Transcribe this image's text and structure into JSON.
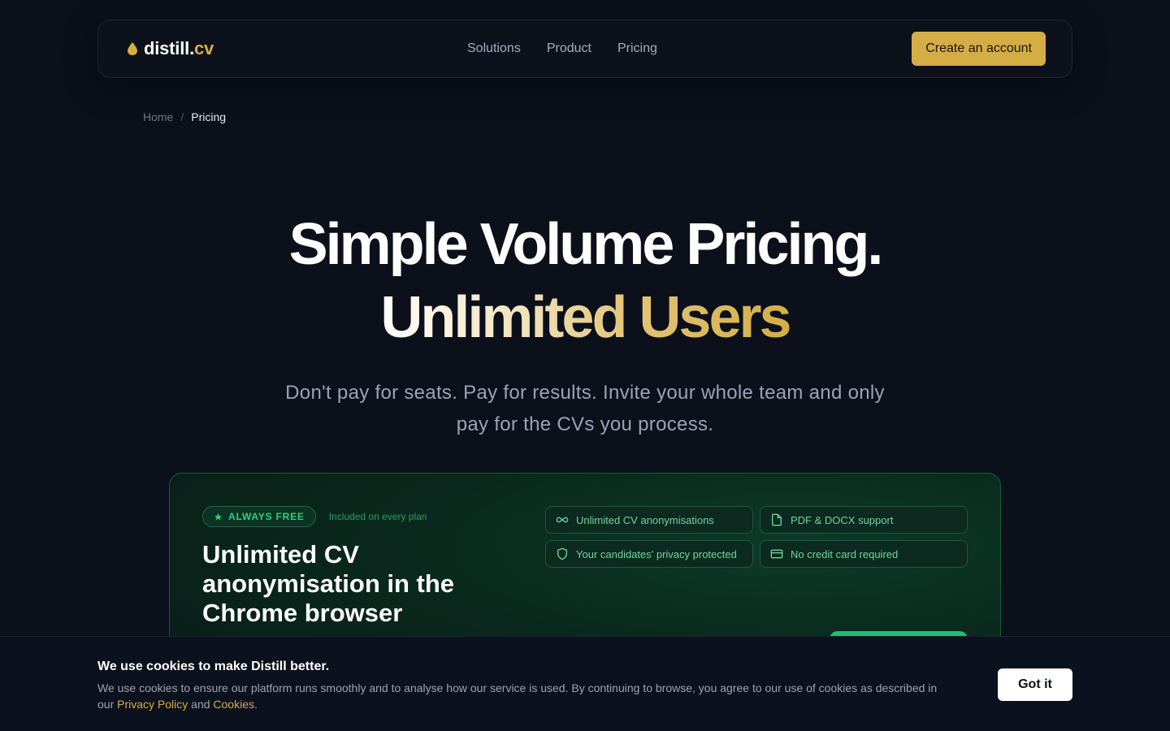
{
  "nav": {
    "logo_name": "distill",
    "logo_dot": ".",
    "logo_tld": "cv",
    "links": [
      "Solutions",
      "Product",
      "Pricing"
    ],
    "cta_label": "Create an account"
  },
  "breadcrumb": {
    "home": "Home",
    "separator": "/",
    "current": "Pricing"
  },
  "hero": {
    "title_line1": "Simple Volume Pricing.",
    "title_line2": "Unlimited Users",
    "subtitle": "Don't pay for seats. Pay for results. Invite your whole team and only pay for the CVs you process."
  },
  "free_card": {
    "badge": "ALWAYS FREE",
    "badge_note": "Included on every plan",
    "title": "Unlimited CV anonymisation in the Chrome browser",
    "features": [
      {
        "label": "Unlimited CV anonymisations",
        "icon": "infinity-icon"
      },
      {
        "label": "PDF & DOCX support",
        "icon": "file-icon"
      },
      {
        "label": "Your candidates' privacy protected",
        "icon": "shield-icon"
      },
      {
        "label": "No credit card required",
        "icon": "credit-card-icon"
      }
    ]
  },
  "cookie": {
    "title": "We use cookies to make Distill better.",
    "text_before": "We use cookies to ensure our platform runs smoothly and to analyse how our service is used. By continuing to browse, you agree to our use of cookies as described in our ",
    "privacy_link": "Privacy Policy",
    "and": " and ",
    "cookies_link": "Cookies",
    "period": ".",
    "button": "Got it"
  },
  "colors": {
    "background": "#0b101b",
    "accent_gold": "#d4ae45",
    "accent_green": "#1fbe74"
  }
}
